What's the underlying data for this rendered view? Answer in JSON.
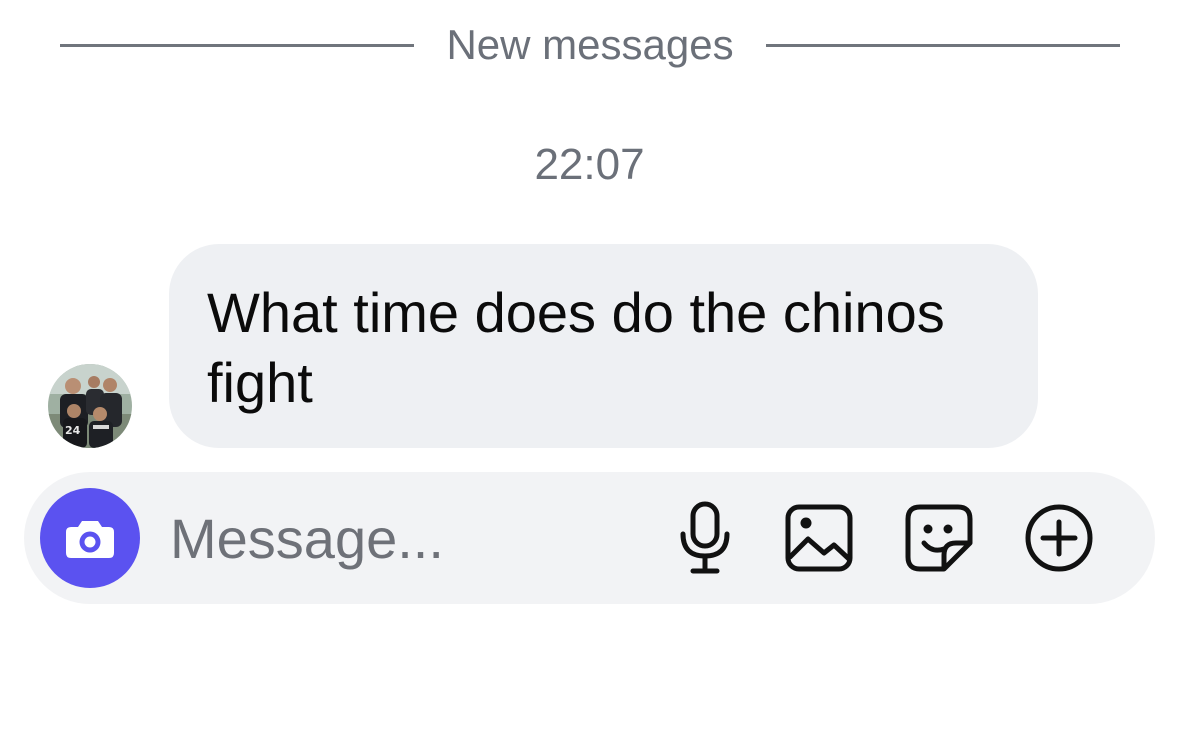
{
  "divider": {
    "label": "New messages"
  },
  "thread": {
    "timestamp": "22:07",
    "messages": [
      {
        "text": "What time does do the chinos fight",
        "direction": "incoming"
      }
    ]
  },
  "composer": {
    "placeholder": "Message...",
    "icons": [
      "camera-icon",
      "microphone-icon",
      "gallery-icon",
      "sticker-icon",
      "plus-icon"
    ]
  },
  "colors": {
    "accent": "#5b52f0",
    "bubble": "#eef0f3",
    "composer": "#f2f3f5",
    "muted_text": "#6b7079"
  }
}
